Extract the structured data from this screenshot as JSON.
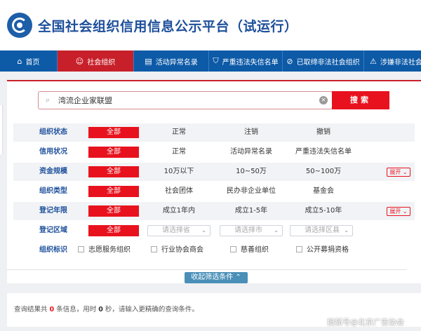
{
  "header": {
    "title": "全国社会组织信用信息公示平台（试运行）"
  },
  "nav": [
    {
      "label": "首页",
      "icon": "home-icon",
      "glyph": "⌂"
    },
    {
      "label": "社会组织",
      "icon": "users-icon",
      "glyph": "☺"
    },
    {
      "label": "活动异常名录",
      "icon": "document-icon",
      "glyph": "▤"
    },
    {
      "label": "严重违法失信名单",
      "icon": "shield-icon",
      "glyph": "⛉"
    },
    {
      "label": "已取缔非法社会组织",
      "icon": "ban-icon",
      "glyph": "⊘"
    },
    {
      "label": "涉嫌非法社会组织",
      "icon": "alert-icon",
      "glyph": "⚠"
    }
  ],
  "search": {
    "value": "湾流企业家联盟",
    "button": "搜索"
  },
  "filters": {
    "all": "全部",
    "expand": "展开",
    "status": {
      "label": "组织状态",
      "options": [
        "正常",
        "注销",
        "撤销"
      ]
    },
    "credit": {
      "label": "信用状况",
      "options": [
        "正常",
        "活动异常名录",
        "严重违法失信名单"
      ]
    },
    "fund": {
      "label": "资金规模",
      "options": [
        "10万以下",
        "10~50万",
        "50~100万"
      ]
    },
    "type": {
      "label": "组织类型",
      "options": [
        "社会团体",
        "民办非企业单位",
        "基金会"
      ]
    },
    "years": {
      "label": "登记年限",
      "options": [
        "成立1年内",
        "成立1-5年",
        "成立5-10年"
      ]
    },
    "region": {
      "label": "登记区域",
      "selects": [
        "请选择省",
        "请选择市",
        "请选择区县"
      ]
    },
    "tags": {
      "label": "组织标识",
      "options": [
        "志愿服务组织",
        "行业协会商会",
        "慈善组织",
        "公开募捐资格"
      ]
    },
    "collapse": "收起筛选条件"
  },
  "result": {
    "prefix": "查询结果共",
    "count": "0",
    "mid": "条信息，用时",
    "time": "0",
    "suffix": "秒，请输入更精确的查询条件。"
  },
  "watermark": "搜狐号@北京广告协会",
  "colors": {
    "brand_blue": "#0d5aa7",
    "accent_red": "#e8121e",
    "label_blue": "#1d4f9b"
  }
}
